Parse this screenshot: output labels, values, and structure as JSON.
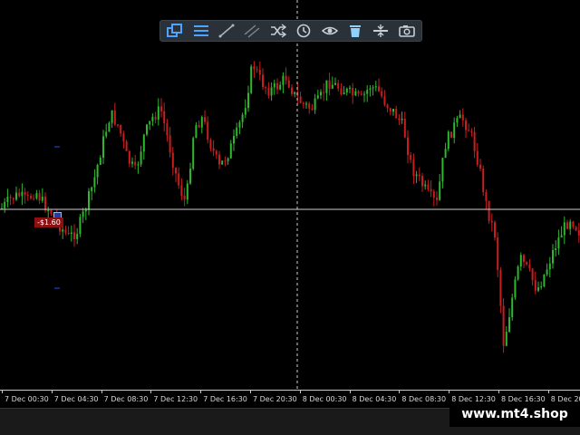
{
  "toolbar": {
    "buttons": [
      {
        "icon": "windows-icon",
        "active": true
      },
      {
        "icon": "menu-lines-icon"
      },
      {
        "icon": "trendline-icon"
      },
      {
        "icon": "parallel-lines-icon"
      },
      {
        "icon": "shuffle-icon"
      },
      {
        "icon": "clock-icon"
      },
      {
        "icon": "eye-icon"
      },
      {
        "icon": "trash-icon"
      },
      {
        "icon": "split-icon"
      },
      {
        "icon": "camera-icon"
      }
    ]
  },
  "trade": {
    "pl_label": "-$1.60",
    "color": "#8c1010"
  },
  "time_axis": {
    "labels": [
      "7 Dec 00:30",
      "7 Dec 04:30",
      "7 Dec 08:30",
      "7 Dec 12:30",
      "7 Dec 16:30",
      "7 Dec 20:30",
      "8 Dec 00:30",
      "8 Dec 04:30",
      "8 Dec 08:30",
      "8 Dec 12:30",
      "8 Dec 16:30",
      "8 Dec 20"
    ]
  },
  "watermark": "www.mt4.shop",
  "colors": {
    "bull": "#2eb82e",
    "bear": "#c81e1e",
    "crosshair": "#d0d0d0",
    "background": "#000000"
  },
  "chart_data": {
    "type": "candlestick",
    "close_path": [
      230,
      220,
      215,
      222,
      210,
      225,
      235,
      250,
      262,
      255,
      230,
      200,
      160,
      125,
      140,
      175,
      190,
      150,
      130,
      120,
      160,
      200,
      225,
      140,
      130,
      160,
      185,
      170,
      150,
      120,
      70,
      90,
      100,
      95,
      85,
      105,
      115,
      120,
      110,
      90,
      95,
      100,
      105,
      110,
      95,
      100,
      115,
      125,
      140,
      185,
      200,
      215,
      225,
      160,
      140,
      130,
      145,
      180,
      230,
      260,
      380,
      330,
      285,
      300,
      320,
      300,
      275,
      255,
      240,
      255
    ]
  }
}
